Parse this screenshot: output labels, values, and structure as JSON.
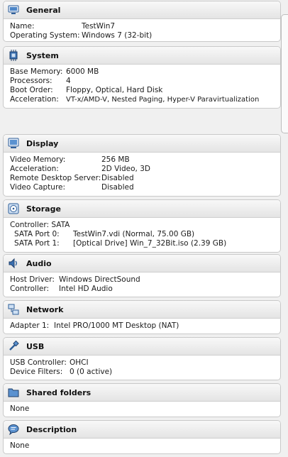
{
  "general": {
    "title": "General",
    "rows": [
      {
        "label": "Name:",
        "value": "TestWin7"
      },
      {
        "label": "Operating System:",
        "value": "Windows 7 (32-bit)"
      }
    ]
  },
  "system": {
    "title": "System",
    "rows": [
      {
        "label": "Base Memory:",
        "value": "6000 MB"
      },
      {
        "label": "Processors:",
        "value": "4"
      },
      {
        "label": "Boot Order:",
        "value": "Floppy, Optical, Hard Disk"
      },
      {
        "label": "Acceleration:",
        "value": "VT-x/AMD-V, Nested Paging, Hyper-V Paravirtualization"
      }
    ]
  },
  "display": {
    "title": "Display",
    "rows": [
      {
        "label": "Video Memory:",
        "value": "256 MB"
      },
      {
        "label": "Acceleration:",
        "value": "2D Video, 3D"
      },
      {
        "label": "Remote Desktop Server:",
        "value": "Disabled"
      },
      {
        "label": "Video Capture:",
        "value": "Disabled"
      }
    ]
  },
  "storage": {
    "title": "Storage",
    "controller": "Controller: SATA",
    "rows": [
      {
        "label": "SATA Port 0:",
        "value": "TestWin7.vdi (Normal, 75.00 GB)"
      },
      {
        "label": "SATA Port 1:",
        "value": "[Optical Drive] Win_7_32Bit.iso (2.39 GB)"
      }
    ]
  },
  "audio": {
    "title": "Audio",
    "rows": [
      {
        "label": "Host Driver:",
        "value": "Windows DirectSound"
      },
      {
        "label": "Controller:",
        "value": "Intel HD Audio"
      }
    ]
  },
  "network": {
    "title": "Network",
    "rows": [
      {
        "label": "Adapter 1:",
        "value": "Intel PRO/1000 MT Desktop (NAT)"
      }
    ]
  },
  "usb": {
    "title": "USB",
    "rows": [
      {
        "label": "USB Controller:",
        "value": "OHCI"
      },
      {
        "label": "Device Filters:",
        "value": "0 (0 active)"
      }
    ]
  },
  "shared_folders": {
    "title": "Shared folders",
    "value": "None"
  },
  "description": {
    "title": "Description",
    "value": "None"
  }
}
